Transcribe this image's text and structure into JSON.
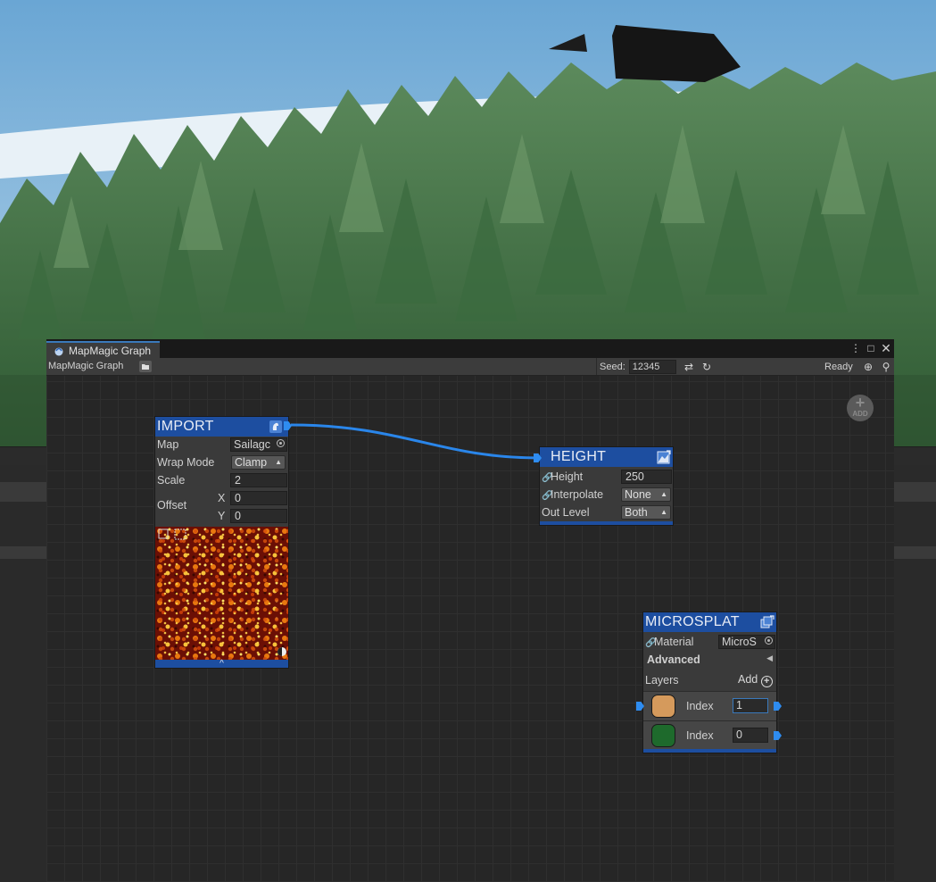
{
  "window": {
    "tab_title": "MapMagic Graph",
    "menu_icon": "vertical-ellipsis-icon",
    "maximize_icon": "maximize-icon",
    "close_icon": "close-icon"
  },
  "toolbar": {
    "title": "MapMagic Graph",
    "folder_icon": "folder-icon",
    "seed_label": "Seed:",
    "seed_value": "12345",
    "refresh_icon": "refresh-icon",
    "regenerate_icon": "rotate-icon",
    "status": "Ready",
    "focus_icon": "focus-target-icon",
    "zoom_icon": "zoom-icon"
  },
  "canvas": {
    "add_button": {
      "plus": "+",
      "label": "ADD"
    }
  },
  "nodes": {
    "import": {
      "title": "IMPORT",
      "rows": {
        "map": {
          "label": "Map",
          "value": "Sailagc"
        },
        "wrap_mode": {
          "label": "Wrap Mode",
          "value": "Clamp"
        },
        "scale": {
          "label": "Scale",
          "value": "2"
        },
        "offset": {
          "label": "Offset",
          "x_label": "X",
          "x_value": "0",
          "y_label": "Y",
          "y_value": "0"
        }
      },
      "collapse_icon": "^"
    },
    "height": {
      "title": "HEIGHT",
      "rows": {
        "height": {
          "label": "Height",
          "value": "250"
        },
        "interpolate": {
          "label": "Interpolate",
          "value": "None"
        },
        "out_level": {
          "label": "Out Level",
          "value": "Both"
        }
      }
    },
    "microsplat": {
      "title": "MICROSPLAT",
      "rows": {
        "material": {
          "label": "Material",
          "value": "MicroS"
        },
        "advanced": {
          "label": "Advanced"
        },
        "layers": {
          "label": "Layers",
          "add_label": "Add"
        }
      },
      "layers": [
        {
          "label": "Index",
          "value": "1",
          "color": "#d59a5c"
        },
        {
          "label": "Index",
          "value": "0",
          "color": "#1e6a2c"
        }
      ]
    }
  },
  "colors": {
    "node_header": "#1d4ea0",
    "port": "#2e8cf0",
    "link": "#2a86ea"
  }
}
